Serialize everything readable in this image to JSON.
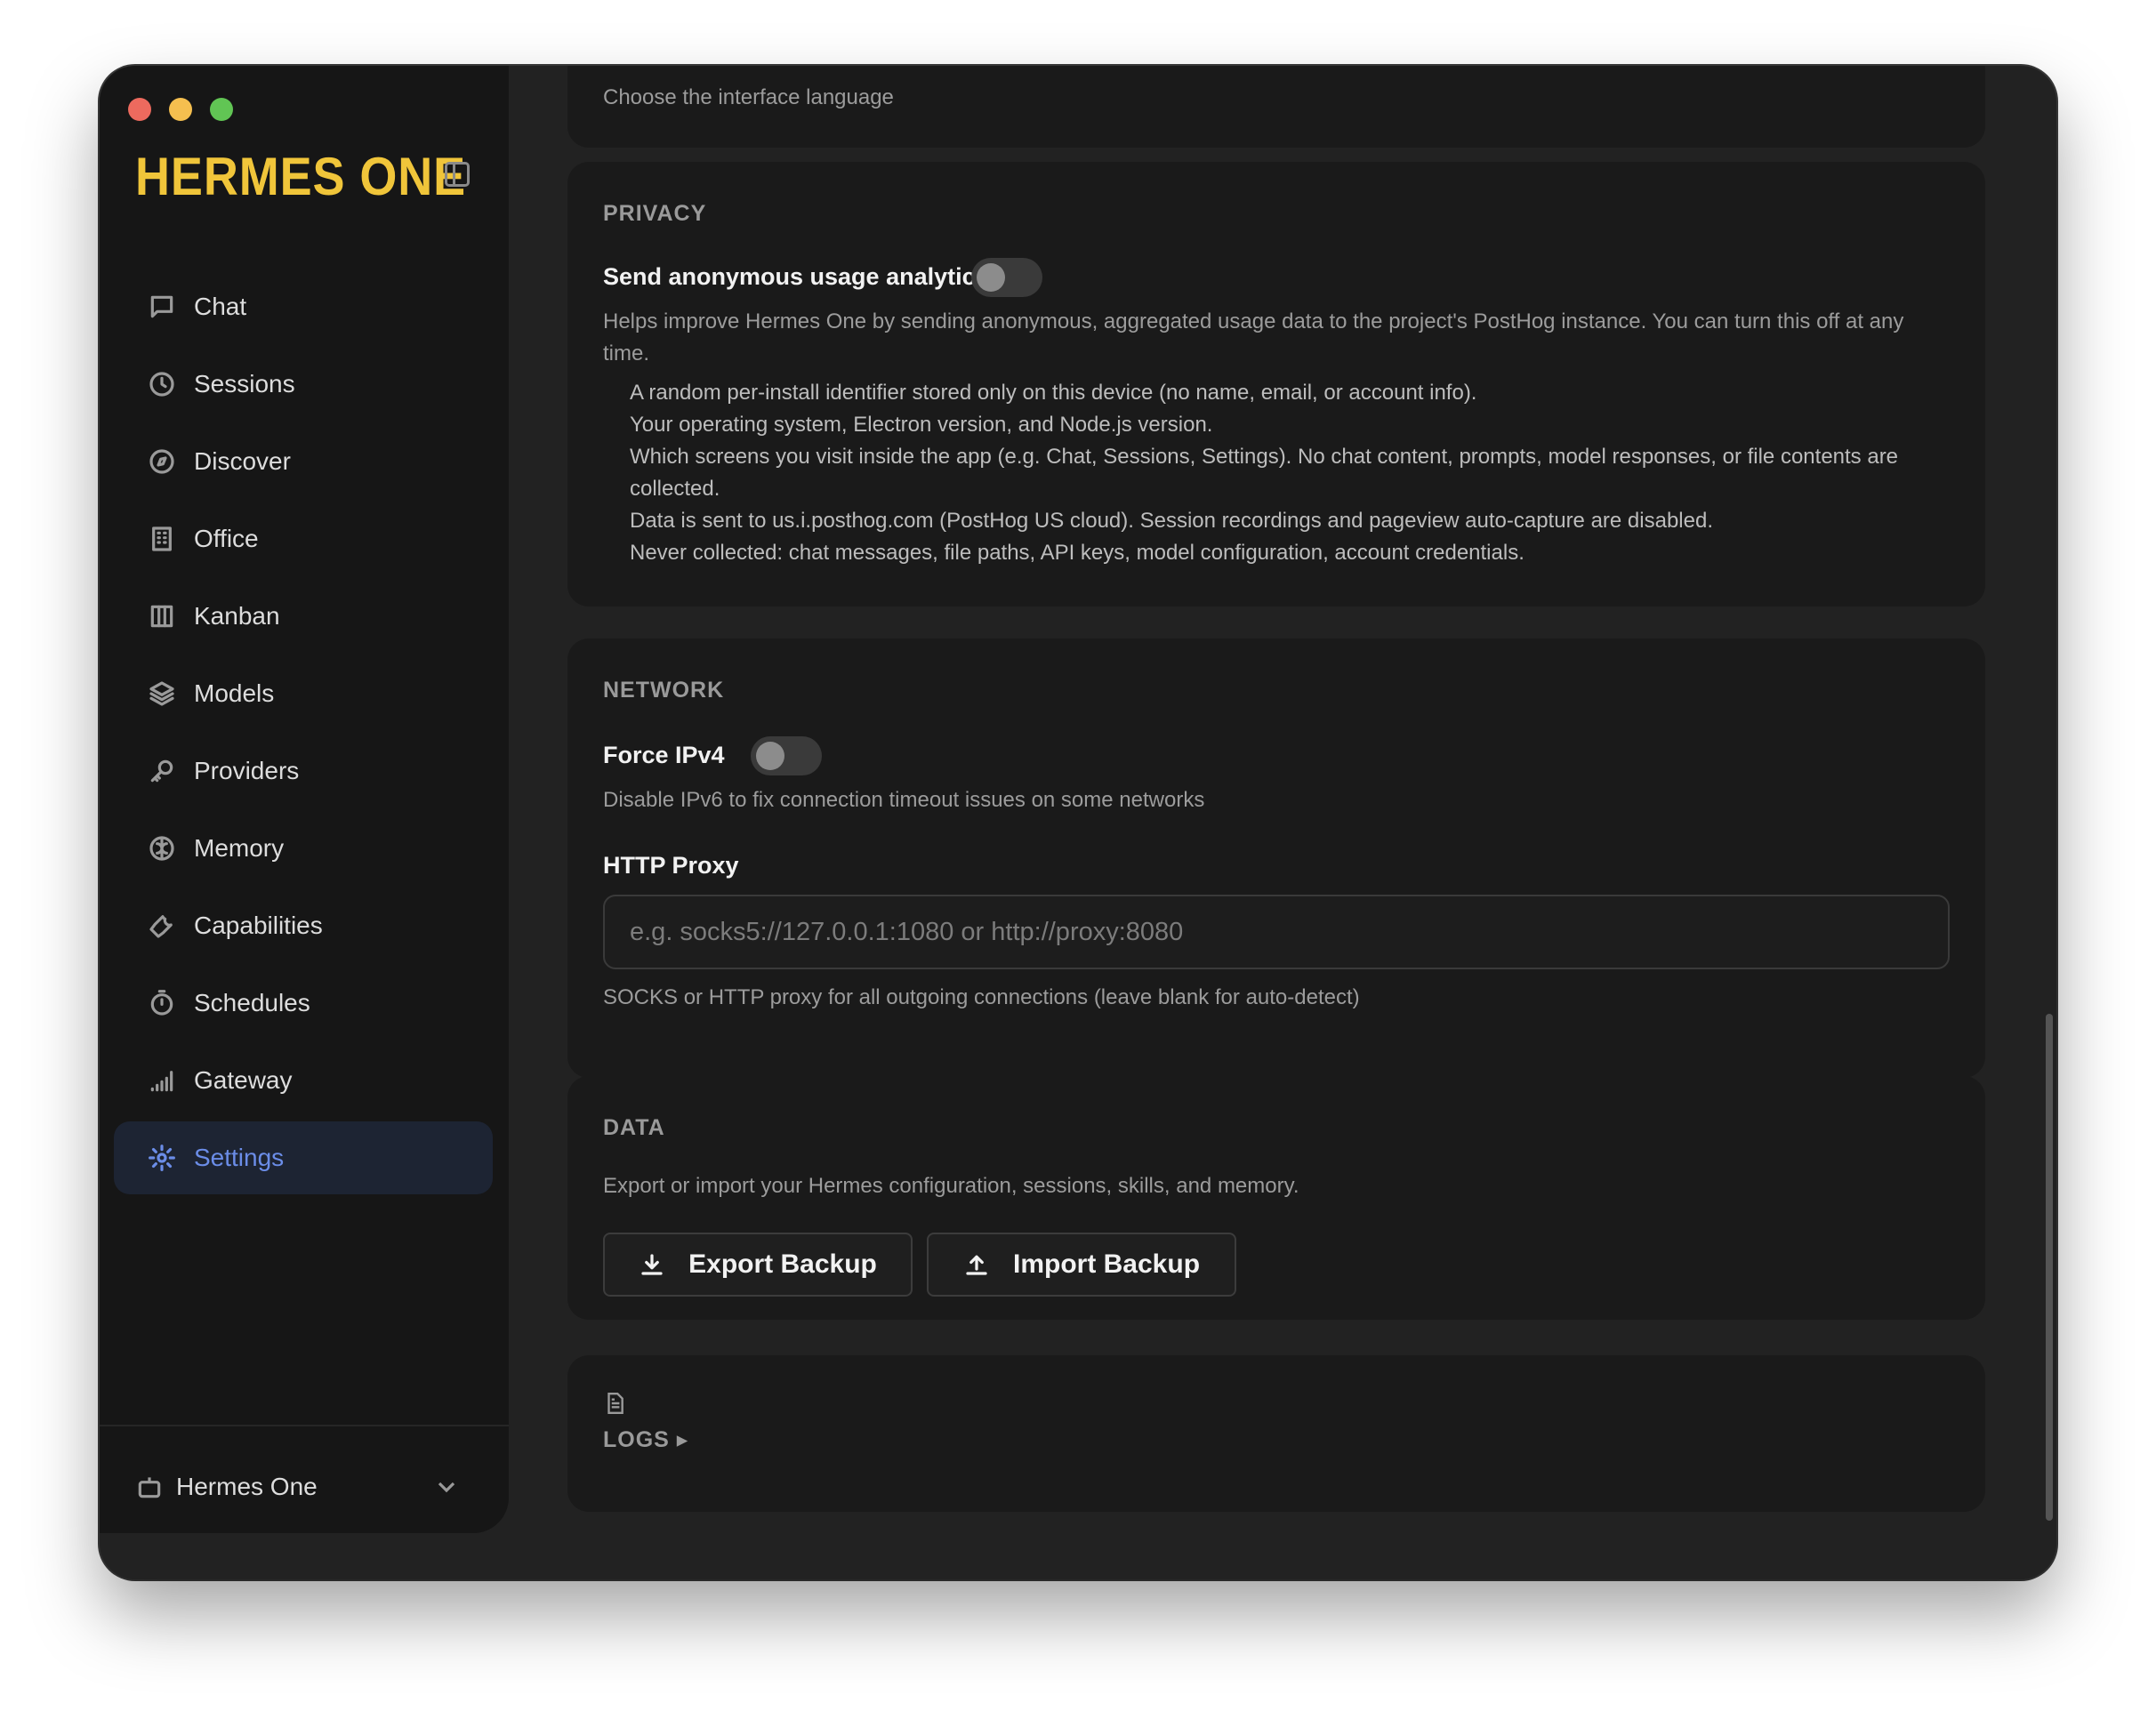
{
  "app": {
    "brand": "HERMES ONE"
  },
  "sidebar": {
    "items": [
      {
        "label": "Chat",
        "icon": "chat-icon"
      },
      {
        "label": "Sessions",
        "icon": "clock-icon"
      },
      {
        "label": "Discover",
        "icon": "compass-icon"
      },
      {
        "label": "Office",
        "icon": "building-icon"
      },
      {
        "label": "Kanban",
        "icon": "kanban-icon"
      },
      {
        "label": "Models",
        "icon": "layers-icon"
      },
      {
        "label": "Providers",
        "icon": "key-icon"
      },
      {
        "label": "Memory",
        "icon": "brain-icon"
      },
      {
        "label": "Capabilities",
        "icon": "wrench-icon"
      },
      {
        "label": "Schedules",
        "icon": "timer-icon"
      },
      {
        "label": "Gateway",
        "icon": "signal-icon"
      },
      {
        "label": "Settings",
        "icon": "gear-icon",
        "active": true
      }
    ],
    "profile": {
      "label": "Hermes One",
      "icon": "robot-icon"
    }
  },
  "language": {
    "description": "Choose the interface language"
  },
  "privacy": {
    "title": "PRIVACY",
    "analytics_label": "Send anonymous usage analytics",
    "analytics_enabled": false,
    "description": "Helps improve Hermes One by sending anonymous, aggregated usage data to the project's PostHog instance. You can turn this off at any time.",
    "bullets": [
      "A random per-install identifier stored only on this device (no name, email, or account info).",
      "Your operating system, Electron version, and Node.js version.",
      "Which screens you visit inside the app (e.g. Chat, Sessions, Settings). No chat content, prompts, model responses, or file contents are collected.",
      "Data is sent to us.i.posthog.com (PostHog US cloud). Session recordings and pageview auto-capture are disabled.",
      "Never collected: chat messages, file paths, API keys, model configuration, account credentials."
    ]
  },
  "network": {
    "title": "NETWORK",
    "ipv4_label": "Force IPv4",
    "ipv4_enabled": false,
    "ipv4_description": "Disable IPv6 to fix connection timeout issues on some networks",
    "proxy_label": "HTTP Proxy",
    "proxy_value": "",
    "proxy_placeholder": "e.g. socks5://127.0.0.1:1080 or http://proxy:8080",
    "proxy_description": "SOCKS or HTTP proxy for all outgoing connections (leave blank for auto-detect)"
  },
  "data": {
    "title": "DATA",
    "description": "Export or import your Hermes configuration, sessions, skills, and memory.",
    "export_label": "Export Backup",
    "import_label": "Import Backup"
  },
  "logs": {
    "title": "LOGS ▸"
  },
  "colors": {
    "brand": "#f0c53a",
    "accent": "#6b8de8",
    "background": "#222222"
  }
}
